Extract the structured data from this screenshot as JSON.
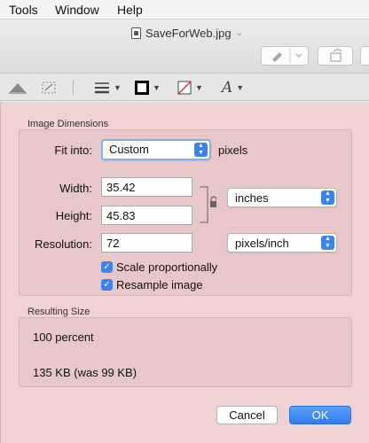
{
  "menu": {
    "items": [
      "Tools",
      "Window",
      "Help"
    ]
  },
  "window": {
    "title": "SaveForWeb.jpg"
  },
  "toolbar": {
    "icons": [
      "markup-pen-icon",
      "rotate-icon",
      "adjust-color-icon",
      "resize-icon",
      "line-style-icon",
      "border-color-icon",
      "fill-color-icon",
      "text-style-icon"
    ]
  },
  "dialog": {
    "image_dimensions_label": "Image Dimensions",
    "fit_into_label": "Fit into:",
    "fit_into_value": "Custom",
    "fit_into_unit": "pixels",
    "width_label": "Width:",
    "width_value": "35.42",
    "height_label": "Height:",
    "height_value": "45.83",
    "size_unit": "inches",
    "resolution_label": "Resolution:",
    "resolution_value": "72",
    "resolution_unit": "pixels/inch",
    "scale_label": "Scale proportionally",
    "scale_checked": true,
    "resample_label": "Resample image",
    "resample_checked": true,
    "resulting_size_label": "Resulting Size",
    "percent_text": "100 percent",
    "size_text": "135 KB (was 99 KB)",
    "cancel_label": "Cancel",
    "ok_label": "OK"
  },
  "colors": {
    "sheet_bg": "#f0d2d3",
    "accent": "#3b82f5"
  }
}
